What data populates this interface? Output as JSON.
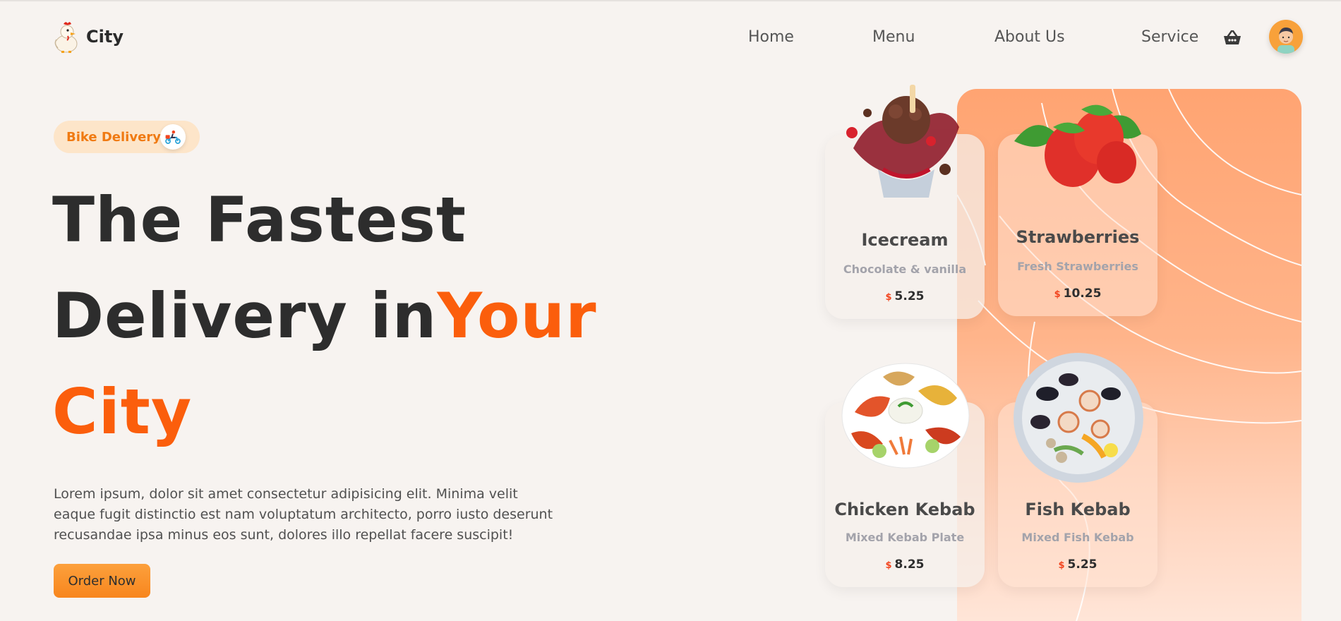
{
  "brand": {
    "name": "City"
  },
  "nav": {
    "items": [
      "Home",
      "Menu",
      "About Us",
      "Service"
    ]
  },
  "header_icons": {
    "cart": "basket-icon",
    "profile": "avatar"
  },
  "hero": {
    "badge_label": "Bike Delivery",
    "badge_icon": "scooter-rider-icon",
    "line1": "The Fastest",
    "line2_dark": "Delivery in",
    "line2_accent": "Your",
    "line3_accent": "City",
    "description": "Lorem ipsum, dolor sit amet consectetur adipisicing elit. Minima velit eaque fugit distinctio est nam voluptatum architecto, porro iusto deserunt recusandae ipsa minus eos sunt, dolores illo repellat facere suscipit!",
    "cta": "Order Now"
  },
  "products": [
    {
      "name": "Icecream",
      "subtitle": "Chocolate & vanilla",
      "currency": "$",
      "price": "5.25"
    },
    {
      "name": "Strawberries",
      "subtitle": "Fresh Strawberries",
      "currency": "$",
      "price": "10.25"
    },
    {
      "name": "Chicken Kebab",
      "subtitle": "Mixed Kebab Plate",
      "currency": "$",
      "price": "8.25"
    },
    {
      "name": "Fish Kebab",
      "subtitle": "Mixed Fish Kebab",
      "currency": "$",
      "price": "5.25"
    }
  ],
  "colors": {
    "accent": "#fb5e0c",
    "button": "#f8861e",
    "panel": "#ffa472",
    "background": "#f7f3f0"
  }
}
